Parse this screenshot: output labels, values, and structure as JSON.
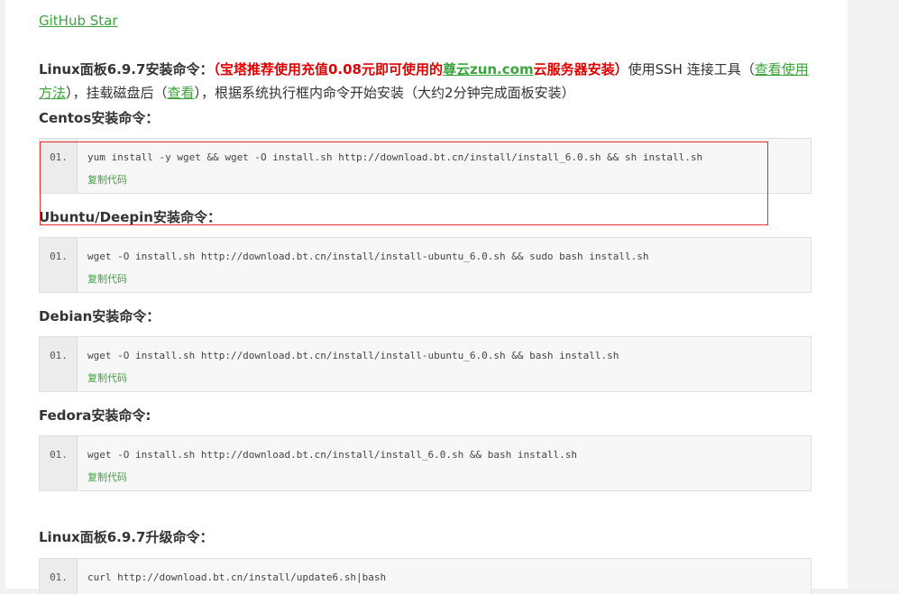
{
  "github_link": "GitHub Star",
  "intro": {
    "part1": "Linux面板6.9.7安装命令：",
    "part2": "（宝塔推荐使用充值0.08元即可使用的",
    "part3": "尊云zun.com",
    "part4": "云服务器安装）",
    "part5": "使用SSH 连接工具（",
    "link1": "查看使用方法",
    "part6": "），挂载磁盘后（",
    "link2": "查看",
    "part7": "），根据系统执行框内命令开始安装（大约2分钟完成面板安装）"
  },
  "sections": [
    {
      "heading": "Centos安装命令：",
      "line_no": "01.",
      "code": "yum install -y wget && wget -O install.sh http://download.bt.cn/install/install_6.0.sh && sh install.sh",
      "copy": "复制代码"
    },
    {
      "heading": "Ubuntu/Deepin安装命令：",
      "line_no": "01.",
      "code": "wget -O install.sh http://download.bt.cn/install/install-ubuntu_6.0.sh && sudo bash install.sh",
      "copy": "复制代码"
    },
    {
      "heading": "Debian安装命令：",
      "line_no": "01.",
      "code": "wget -O install.sh http://download.bt.cn/install/install-ubuntu_6.0.sh && bash install.sh",
      "copy": "复制代码"
    },
    {
      "heading": "Fedora安装命令:",
      "line_no": "01.",
      "code": "wget -O install.sh http://download.bt.cn/install/install_6.0.sh && bash install.sh",
      "copy": "复制代码"
    }
  ],
  "upgrade": {
    "heading": "Linux面板6.9.7升级命令：",
    "line_no": "01.",
    "code": "curl http://download.bt.cn/install/update6.sh|bash"
  },
  "colors": {
    "link_green": "#3ba53b",
    "promo_red": "#e00000",
    "highlight_red": "#e03030"
  }
}
